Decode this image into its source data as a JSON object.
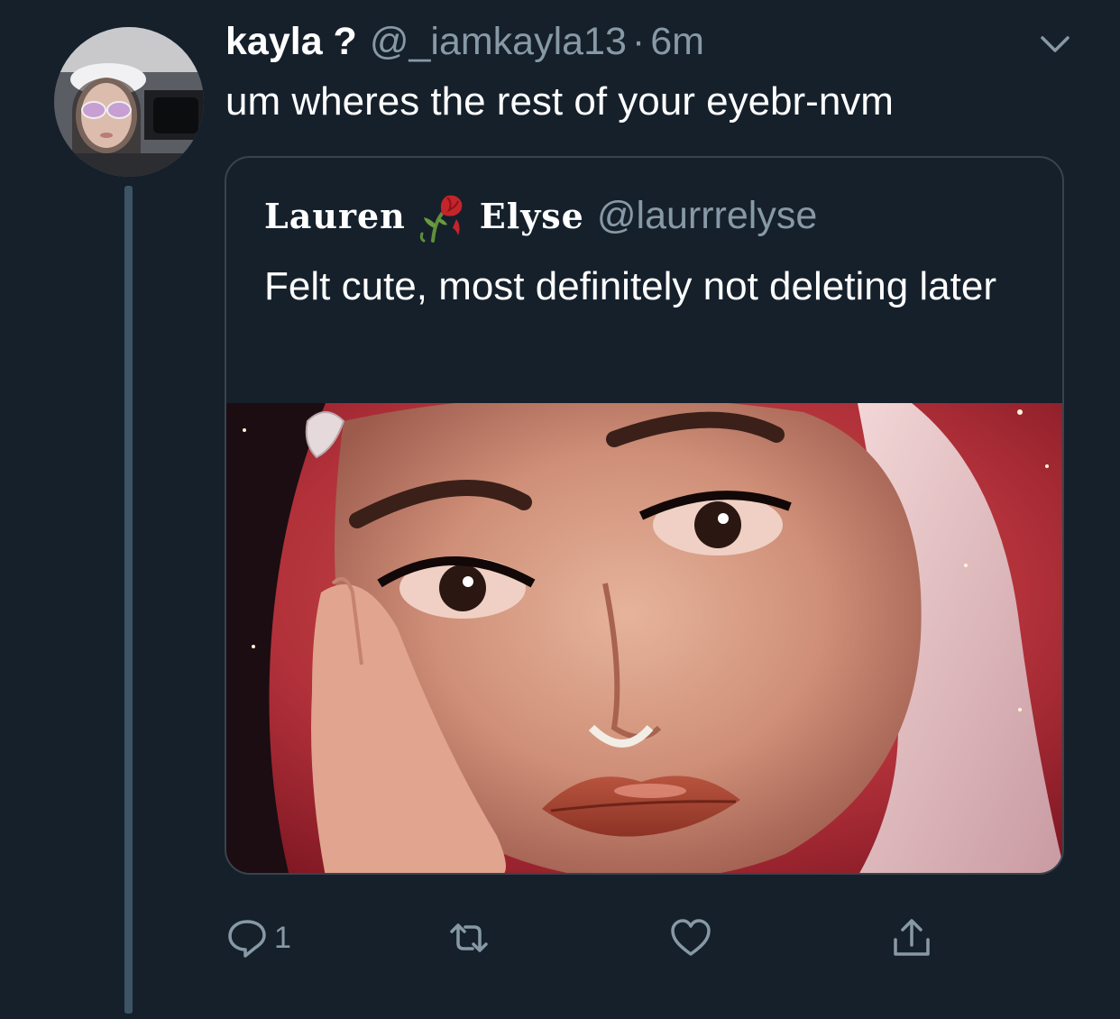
{
  "tweet": {
    "display_name": "kayla ?",
    "handle": "@_iamkayla13",
    "separator": "·",
    "time": "6m",
    "text": "um wheres the rest of your eyebr-nvm"
  },
  "quoted_tweet": {
    "name_first": "Lauren",
    "name_emoji": "wilted-rose-icon",
    "name_last": "Elyse",
    "handle": "@laurrrelyse",
    "text": "Felt cute, most definitely not deleting later"
  },
  "actions": {
    "reply_count": "1",
    "icons": [
      "reply-icon",
      "retweet-icon",
      "like-icon",
      "share-icon"
    ]
  },
  "colors": {
    "background": "#15202b",
    "secondary_text": "#8899a6",
    "border": "#38444d",
    "thread_line": "#3d5466"
  }
}
